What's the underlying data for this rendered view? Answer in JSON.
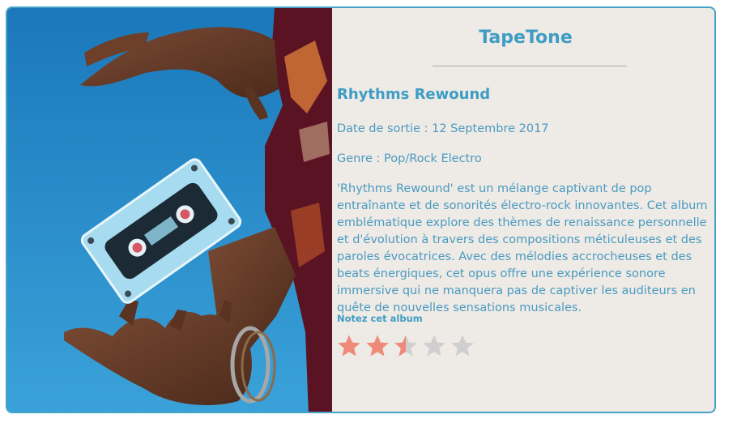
{
  "brand": "TapeTone",
  "album": {
    "title": "Rhythms Rewound",
    "release": "Date de sortie : 12 Septembre 2017",
    "genre": "Genre : Pop/Rock Electro",
    "description": "'Rhythms Rewound' est un mélange captivant de pop entraînante et de sonorités électro-rock innovantes. Cet album emblématique explore des thèmes de renaissance personnelle et d'évolution à travers des compositions méticuleuses et des paroles évocatrices. Avec des mélodies accrocheuses et des beats énergiques, cet opus offre une expérience sonore immersive qui ne manquera pas de captiver les auditeurs en quête de nouvelles sensations musicales."
  },
  "rating": {
    "label": "Notez cet album",
    "value": 2.5,
    "max": 5,
    "filled_color": "#f08a78",
    "empty_color": "#cfcfcf"
  },
  "colors": {
    "accent": "#3e9dc4",
    "card_border": "#47a3c6",
    "card_bg": "#eeeae6"
  }
}
